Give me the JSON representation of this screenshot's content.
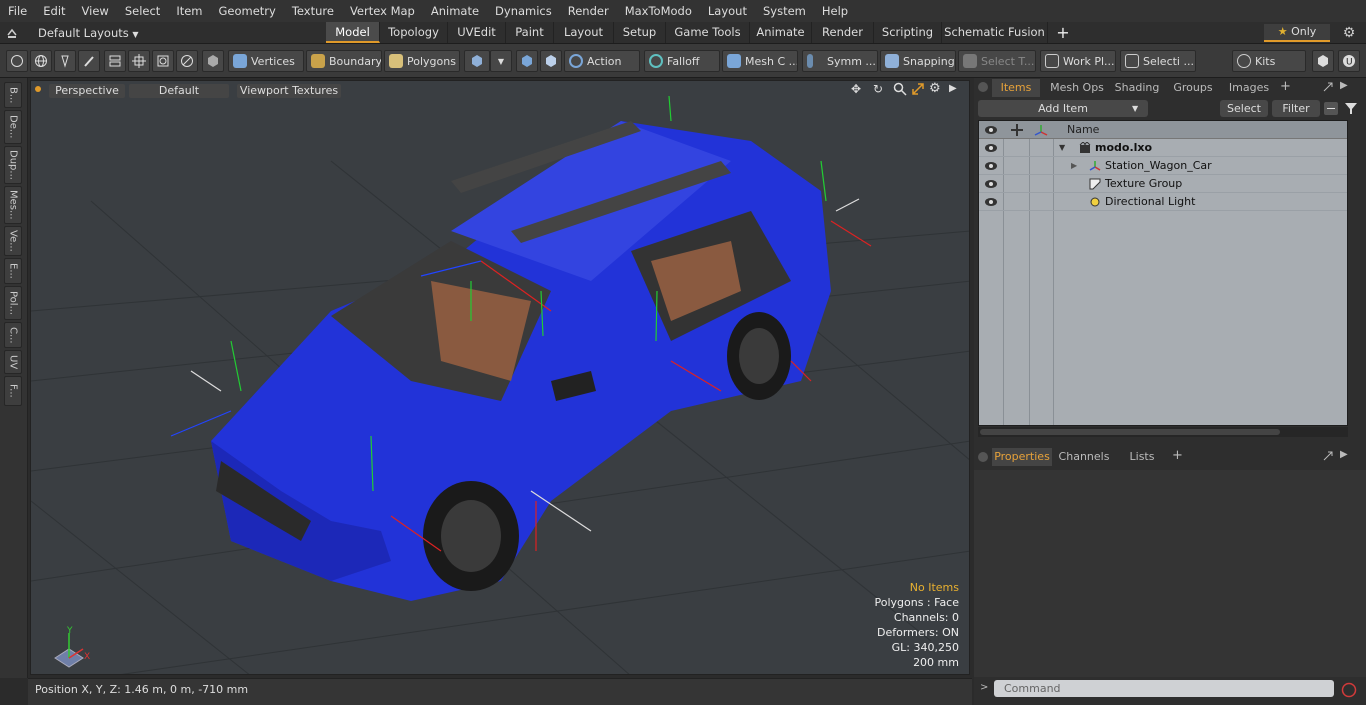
{
  "menu": [
    "File",
    "Edit",
    "View",
    "Select",
    "Item",
    "Geometry",
    "Texture",
    "Vertex Map",
    "Animate",
    "Dynamics",
    "Render",
    "MaxToModo",
    "Layout",
    "System",
    "Help"
  ],
  "layout_dropdown": "Default Layouts",
  "mode_tabs": [
    "Model",
    "Topology",
    "UVEdit",
    "Paint",
    "Layout",
    "Setup",
    "Game Tools",
    "Animate",
    "Render",
    "Scripting",
    "Schematic Fusion"
  ],
  "active_tab": "Model",
  "only_label": "Only",
  "toolbar": {
    "vertices": "Vertices",
    "boundary": "Boundary",
    "polygons": "Polygons",
    "action": "Action",
    "falloff": "Falloff",
    "mesh_c": "Mesh C ...",
    "symm": "Symm ...",
    "snapping": "Snapping",
    "select_t": "Select T...",
    "work_pl": "Work Pl...",
    "selecti": "Selecti ...",
    "kits": "Kits"
  },
  "left_tabs": [
    "B...",
    "De...",
    "Dup...",
    "Mes...",
    "Ve...",
    "E...",
    "Pol...",
    "C...",
    "UV",
    "F..."
  ],
  "viewport": {
    "perspective": "Perspective",
    "default": "Default",
    "textures": "Viewport Textures",
    "info": [
      "No Items",
      "Polygons : Face",
      "Channels: 0",
      "Deformers: ON",
      "GL: 340,250",
      "200 mm"
    ]
  },
  "status": "Position X, Y, Z:   1.46 m, 0 m, -710 mm",
  "items_panel": {
    "tabs": [
      "Items",
      "Mesh Ops",
      "Shading",
      "Groups",
      "Images"
    ],
    "add_item": "Add Item",
    "select": "Select",
    "filter": "Filter",
    "name_header": "Name",
    "rows": [
      "modo.lxo",
      "Station_Wagon_Car",
      "Texture Group",
      "Directional Light"
    ]
  },
  "props_panel": {
    "tabs": [
      "Properties",
      "Channels",
      "Lists"
    ]
  },
  "command_placeholder": "Command",
  "colors": {
    "accent": "#e09a2a",
    "car": "#2233d8",
    "viewport_bg": "#3a3e42"
  }
}
